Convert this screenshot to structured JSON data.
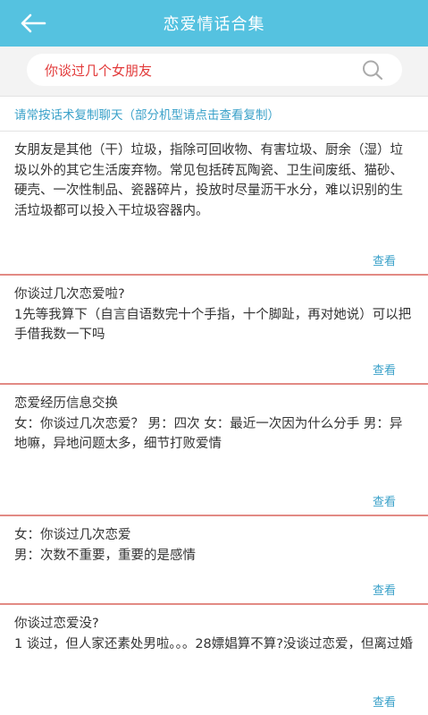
{
  "header": {
    "title": "恋爱情话合集",
    "back_icon": "arrow-left-icon"
  },
  "search": {
    "value": "你谈过几个女朋友",
    "icon": "search-icon",
    "accent": "#e23a3a"
  },
  "hint": "请常按话术复制聊天（部分机型请点击查看复制）",
  "colors": {
    "header_bg": "#55c2e0",
    "link": "#3aa1c9",
    "divider": "#e28a84"
  },
  "cards": [
    {
      "text": "女朋友是其他（干）垃圾，指除可回收物、有害垃圾、厨余（湿）垃圾以外的其它生活废弃物。常见包括砖瓦陶瓷、卫生间废纸、猫砂、硬壳、一次性制品、瓷器碎片，投放时尽量沥干水分，难以识别的生活垃圾都可以投入干垃圾容器内。",
      "action": "查看"
    },
    {
      "text": "你谈过几次恋爱啦?\n1先等我算下（自言自语数完十个手指，十个脚趾，再对她说）可以把手借我数一下吗",
      "action": "查看"
    },
    {
      "text": "恋爱经历信息交换\n女：你谈过几次恋爱？ 男：四次 女：最近一次因为什么分手 男：异地嘛，异地问题太多，细节打败爱情",
      "action": "查看"
    },
    {
      "text": "女：你谈过几次恋爱\n男：次数不重要，重要的是感情",
      "action": "查看"
    },
    {
      "text": "你谈过恋爱没?\n1 谈过，但人家还素处男啦。。。28嫖娼算不算?没谈过恋爱，但离过婚",
      "action": "查看"
    }
  ]
}
